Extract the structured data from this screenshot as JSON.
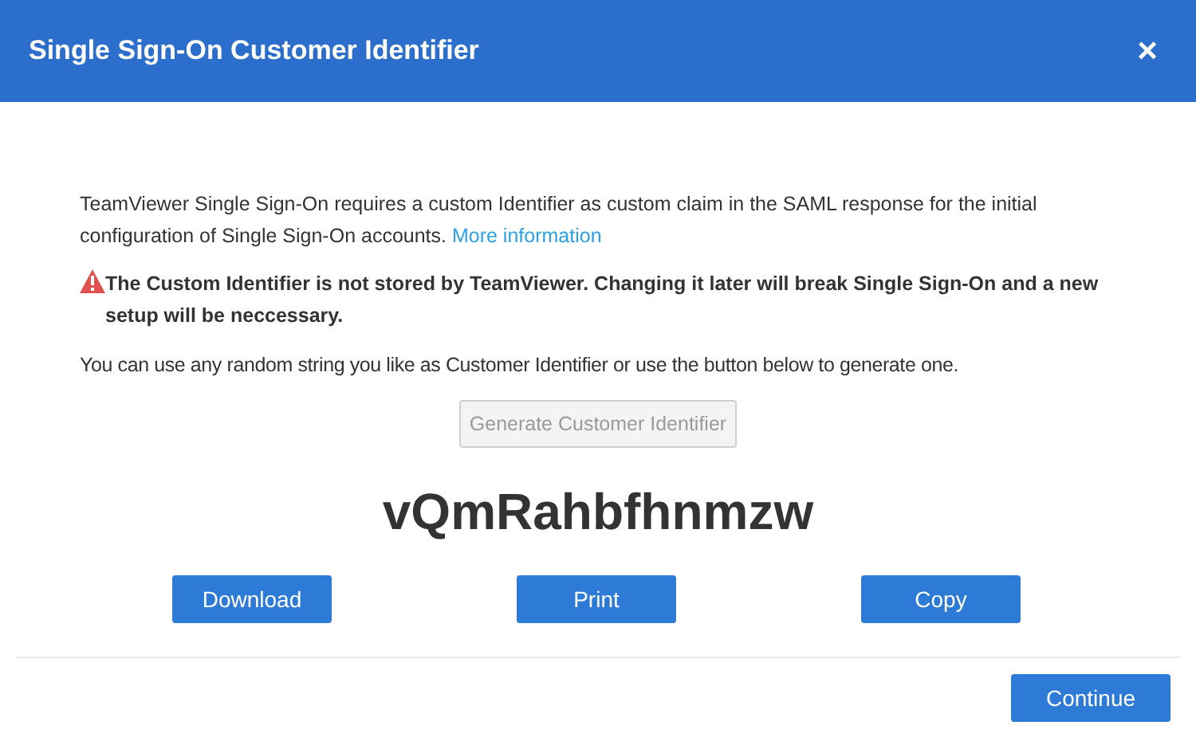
{
  "dialog": {
    "title": "Single Sign-On Customer Identifier",
    "close": "×",
    "intro": "TeamViewer Single Sign-On requires a custom Identifier as custom claim in the SAML response for the initial configuration of Single Sign-On accounts.",
    "link": "More information",
    "warning": "The Custom Identifier is not stored by TeamViewer. Changing it later will break Single Sign-On and a new setup will be neccessary.",
    "hint": "You can use any random string you like as Customer Identifier or use the button below to generate one.",
    "generate_button": {
      "label": "Generate Customer Identifier",
      "disabled": true
    },
    "identifier": "vQmRahbfhnmzw",
    "actions": [
      "Download",
      "Print",
      "Copy"
    ],
    "continue": "Continue"
  }
}
